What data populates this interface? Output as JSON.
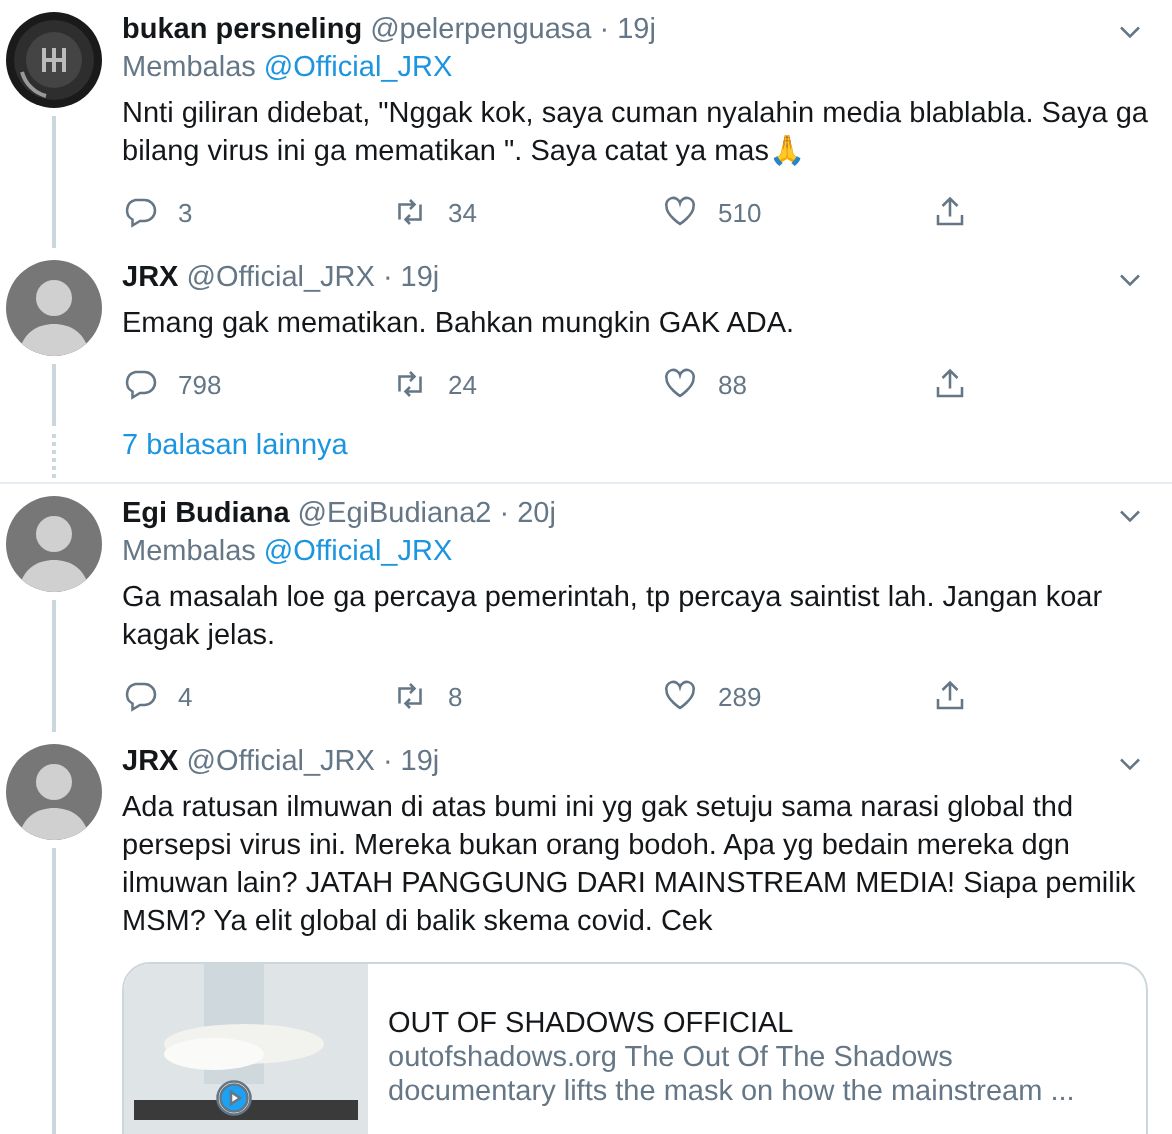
{
  "tweets": [
    {
      "name": "bukan persneling",
      "handle": "@pelerpenguasa",
      "separator": "·",
      "time": "19j",
      "reply_label": "Membalas",
      "reply_to": "@Official_JRX",
      "text": "Nnti giliran didebat, \"Nggak kok, saya cuman nyalahin media blablabla. Saya ga bilang virus ini ga mematikan \". Saya catat ya mas🙏",
      "replies": "3",
      "retweets": "34",
      "likes": "510",
      "thread_line": true
    },
    {
      "name": "JRX",
      "handle": "@Official_JRX",
      "separator": "·",
      "time": "19j",
      "avatar": {
        "kind": "person"
      },
      "text": "Emang gak mematikan. Bahkan mungkin GAK ADA.",
      "replies": "798",
      "retweets": "24",
      "likes": "88",
      "thread_line": true,
      "more_replies": "7 balasan lainnya"
    },
    {
      "name": "Egi Budiana",
      "handle": "@EgiBudiana2",
      "separator": "·",
      "time": "20j",
      "avatar": {
        "kind": "person"
      },
      "reply_label": "Membalas",
      "reply_to": "@Official_JRX",
      "text": "Ga masalah loe ga percaya pemerintah, tp percaya saintist lah. Jangan koar kagak jelas.",
      "replies": "4",
      "retweets": "8",
      "likes": "289",
      "thread_line": true
    },
    {
      "name": "JRX",
      "handle": "@Official_JRX",
      "separator": "·",
      "time": "19j",
      "avatar": {
        "kind": "person"
      },
      "thread_line": true,
      "text": "Ada ratusan ilmuwan di atas bumi ini yg gak setuju sama narasi global thd persepsi virus ini. Mereka bukan orang bodoh. Apa yg bedain mereka dgn ilmuwan lain? JATAH PANGGUNG DARI MAINSTREAM MEDIA! Siapa pemilik MSM? Ya elit global di balik skema covid. Cek",
      "card": {
        "title": "OUT OF SHADOWS OFFICIAL",
        "description": "outofshadows.org The Out Of The Shadows documentary lifts the mask on how the mainstream ..."
      }
    }
  ]
}
